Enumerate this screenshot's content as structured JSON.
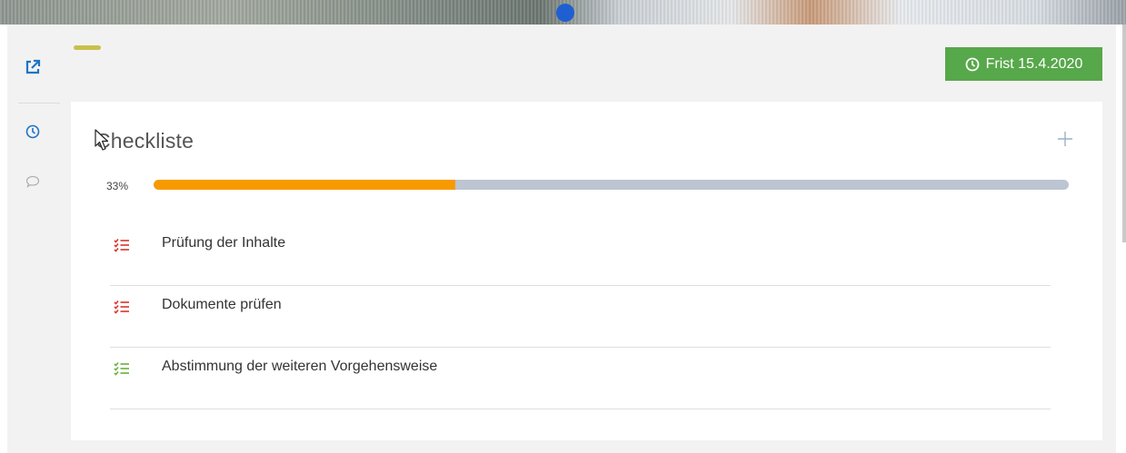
{
  "deadline": {
    "label": "Frist 15.4.2020",
    "color": "#57a84a"
  },
  "checklist": {
    "title": "Checkliste",
    "progress_label": "33%",
    "progress_value": 0.33,
    "progress_color": "#f79a00",
    "items": [
      {
        "label": "Prüfung der Inhalte",
        "icon": "checklist-icon",
        "status_color": "#d9342b"
      },
      {
        "label": "Dokumente prüfen",
        "icon": "checklist-icon",
        "status_color": "#d9342b"
      },
      {
        "label": "Abstimmung der weiteren Vorgehensweise",
        "icon": "checklist-icon",
        "status_color": "#67b13a"
      }
    ]
  },
  "rail": {
    "icons": [
      "external-link-icon",
      "clock-icon",
      "comment-icon"
    ]
  }
}
